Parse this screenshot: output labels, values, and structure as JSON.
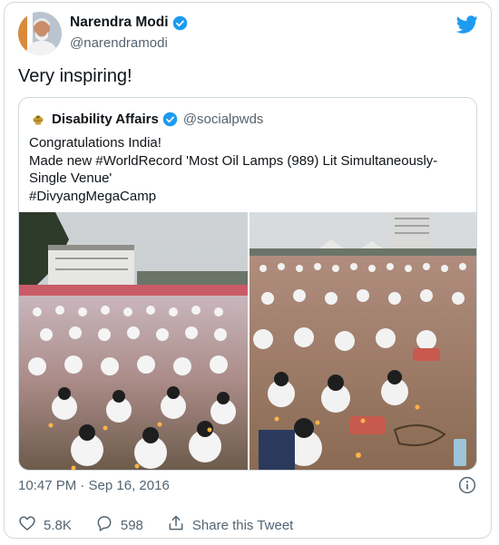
{
  "tweet": {
    "author_name": "Narendra Modi",
    "author_handle": "@narendramodi",
    "text": "Very inspiring!",
    "timestamp": "10:47 PM · Sep 16, 2016"
  },
  "quoted": {
    "author_name": "Disability Affairs",
    "author_handle": "@socialpwds",
    "lines": [
      "Congratulations India!",
      "Made new #WorldRecord 'Most Oil Lamps (989) Lit Simultaneously-Single Venue'",
      "#DivyangMegaCamp"
    ]
  },
  "actions": {
    "like_count": "5.8K",
    "reply_count": "598",
    "share_label": "Share this Tweet"
  },
  "icons": {
    "verified": "verified-badge-icon",
    "twitter": "twitter-bird-icon",
    "info": "info-icon",
    "like": "heart-icon",
    "reply": "reply-icon",
    "share": "share-icon"
  },
  "colors": {
    "twitter_blue": "#1d9bf0",
    "text_primary": "#0f1419",
    "text_secondary": "#536471",
    "border": "#cfd9de"
  }
}
